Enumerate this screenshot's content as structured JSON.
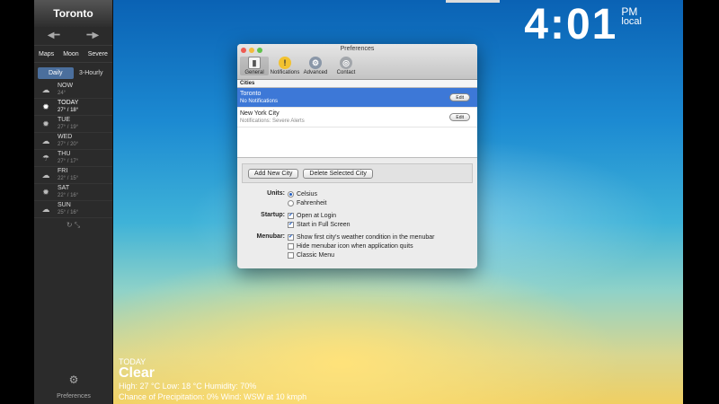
{
  "clock": {
    "time": "4:01",
    "ampm": "PM",
    "zone": "local"
  },
  "sidebar": {
    "city": "Toronto",
    "nav_prev_icon": "arrow-left-icon",
    "nav_next_icon": "arrow-right-icon",
    "tabs": [
      "Maps",
      "Moon",
      "Severe"
    ],
    "modes": [
      "Daily",
      "3-Hourly"
    ],
    "days": [
      {
        "name": "NOW",
        "temps": "24°",
        "icon": "cloud-icon"
      },
      {
        "name": "TODAY",
        "temps": "27° / 18°",
        "icon": "sun-icon"
      },
      {
        "name": "TUE",
        "temps": "27° / 19°",
        "icon": "sun-icon"
      },
      {
        "name": "WED",
        "temps": "27° / 20°",
        "icon": "cloud-icon"
      },
      {
        "name": "THU",
        "temps": "27° / 17°",
        "icon": "rain-icon"
      },
      {
        "name": "FRI",
        "temps": "22° / 15°",
        "icon": "cloud-icon"
      },
      {
        "name": "SAT",
        "temps": "22° / 16°",
        "icon": "sun-icon"
      },
      {
        "name": "SUN",
        "temps": "25° / 16°",
        "icon": "cloud-icon"
      }
    ],
    "preferences_label": "Preferences"
  },
  "summary": {
    "label": "TODAY",
    "condition": "Clear",
    "line1": "High: 27 °C   Low: 18 °C   Humidity: 70%",
    "line2": "Chance of Precipitation: 0%   Wind: WSW at 10 kmph"
  },
  "prefs": {
    "title": "Preferences",
    "toolbar": [
      "General",
      "Notifications",
      "Advanced",
      "Contact"
    ],
    "cities_header": "Cities",
    "cities": [
      {
        "name": "Toronto",
        "note": "No Notifications",
        "edit": "Edit"
      },
      {
        "name": "New York City",
        "note": "Notifications: Severe Alerts",
        "edit": "Edit"
      }
    ],
    "add_city": "Add New City",
    "delete_city": "Delete Selected City",
    "units_label": "Units:",
    "units": [
      "Celsius",
      "Fahrenheit"
    ],
    "startup_label": "Startup:",
    "startup": [
      "Open at Login",
      "Start in Full Screen"
    ],
    "menubar_label": "Menubar:",
    "menubar": [
      "Show first city's weather condition in the menubar",
      "Hide menubar icon when application quits",
      "Classic Menu"
    ]
  }
}
